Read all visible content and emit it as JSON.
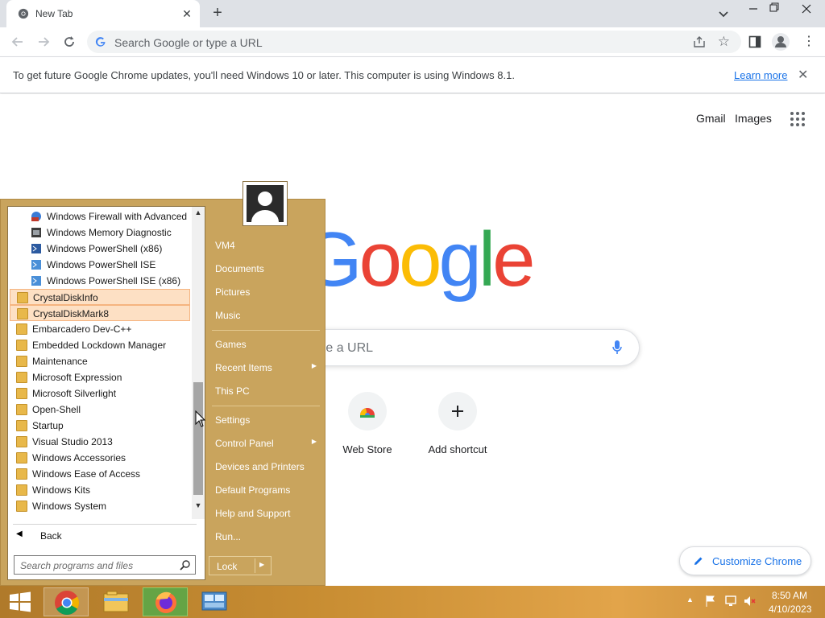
{
  "browser": {
    "tab_title": "New Tab",
    "omnibox_placeholder": "Search Google or type a URL"
  },
  "infobar": {
    "message": "To get future Google Chrome updates, you'll need Windows 10 or later. This computer is using Windows 8.1.",
    "link": "Learn more"
  },
  "ntp": {
    "gmail": "Gmail",
    "images": "Images",
    "search_placeholder": "type a URL",
    "shortcuts": [
      "Web Store",
      "Add shortcut"
    ],
    "customize": "Customize Chrome"
  },
  "start_menu": {
    "programs": [
      {
        "label": "Windows Firewall with Advanced",
        "icon": "firewall-icon"
      },
      {
        "label": "Windows Memory Diagnostic",
        "icon": "memory-diagnostic-icon"
      },
      {
        "label": "Windows PowerShell (x86)",
        "icon": "powershell-icon"
      },
      {
        "label": "Windows PowerShell ISE",
        "icon": "powershell-ise-icon"
      },
      {
        "label": "Windows PowerShell ISE (x86)",
        "icon": "powershell-ise-icon"
      },
      {
        "label": "CrystalDiskInfo",
        "icon": "folder-icon",
        "highlighted": true
      },
      {
        "label": "CrystalDiskMark8",
        "icon": "folder-icon",
        "highlighted": true
      },
      {
        "label": "Embarcadero Dev-C++",
        "icon": "folder-icon"
      },
      {
        "label": "Embedded Lockdown Manager",
        "icon": "folder-icon"
      },
      {
        "label": "Maintenance",
        "icon": "folder-icon"
      },
      {
        "label": "Microsoft Expression",
        "icon": "folder-icon"
      },
      {
        "label": "Microsoft Silverlight",
        "icon": "folder-icon"
      },
      {
        "label": "Open-Shell",
        "icon": "folder-icon"
      },
      {
        "label": "Startup",
        "icon": "folder-icon"
      },
      {
        "label": "Visual Studio 2013",
        "icon": "folder-icon"
      },
      {
        "label": "Windows Accessories",
        "icon": "folder-icon"
      },
      {
        "label": "Windows Ease of Access",
        "icon": "folder-icon"
      },
      {
        "label": "Windows Kits",
        "icon": "folder-icon"
      },
      {
        "label": "Windows System",
        "icon": "folder-icon"
      }
    ],
    "back": "Back",
    "search_placeholder": "Search programs and files",
    "right_items": [
      {
        "label": "VM4"
      },
      {
        "label": "Documents"
      },
      {
        "label": "Pictures"
      },
      {
        "label": "Music"
      },
      {
        "label": "Games"
      },
      {
        "label": "Recent Items",
        "submenu": true
      },
      {
        "label": "This PC"
      },
      {
        "label": "Settings"
      },
      {
        "label": "Control Panel",
        "submenu": true
      },
      {
        "label": "Devices and Printers"
      },
      {
        "label": "Default Programs"
      },
      {
        "label": "Help and Support"
      },
      {
        "label": "Run..."
      }
    ],
    "lock": "Lock"
  },
  "taskbar": {
    "time": "8:50 AM",
    "date": "4/10/2023"
  },
  "colors": {
    "start_menu_bg": "#c9a45d",
    "highlight": "#fde0c4",
    "link": "#1a73e8"
  }
}
